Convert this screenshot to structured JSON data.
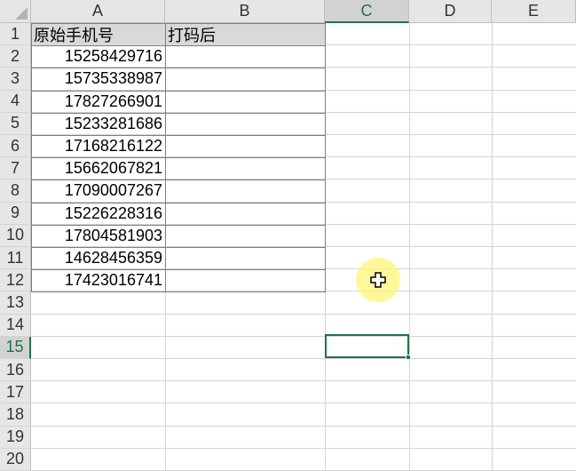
{
  "columns": [
    "A",
    "B",
    "C",
    "D",
    "E"
  ],
  "rows": [
    "1",
    "2",
    "3",
    "4",
    "5",
    "6",
    "7",
    "8",
    "9",
    "10",
    "11",
    "12",
    "13",
    "14",
    "15",
    "16",
    "17",
    "18",
    "19",
    "20"
  ],
  "header_row": {
    "a": "原始手机号",
    "b": "打码后"
  },
  "phone_numbers": [
    "15258429716",
    "15735338987",
    "17827266901",
    "15233281686",
    "17168216122",
    "15662067821",
    "17090007267",
    "15226228316",
    "17804581903",
    "14628456359",
    "17423016741"
  ],
  "active_cell": {
    "column": "C",
    "row": "15"
  },
  "colors": {
    "accent": "#217346",
    "header_fill": "#d9d9d9",
    "cursor_halo": "#fff578"
  },
  "icons": {
    "cursor": "plus-cursor-icon"
  }
}
